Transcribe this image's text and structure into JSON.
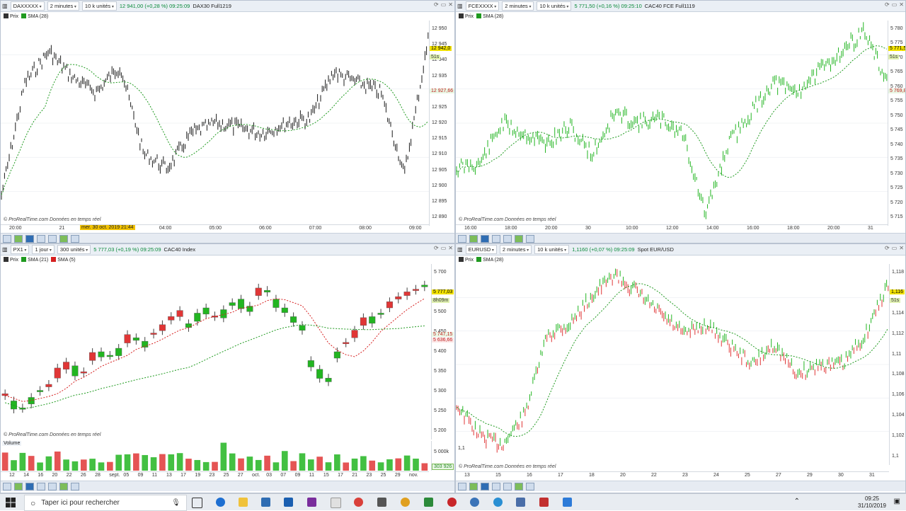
{
  "panels": {
    "dax": {
      "instrument": "DAXXXXX",
      "period": "2 minutes",
      "units": "10 k unités",
      "quote": "12 941,00 (+0,28 %) 09:25:09",
      "name": "DAX30 Full1219",
      "legend": [
        "Prix",
        "SMA (28)"
      ],
      "yticks": [
        "12 950",
        "12 945",
        "12 940",
        "12 935",
        "12 930",
        "12 925",
        "12 920",
        "12 915",
        "12 910",
        "12 905",
        "12 900",
        "12 895",
        "12 890"
      ],
      "tag1": "12 942,0",
      "tag2": "51s",
      "tag3": "12 927,66",
      "xticks": [
        "20:00",
        "21",
        "03:00",
        "04:00",
        "05:00",
        "06:00",
        "07:00",
        "08:00",
        "09:00"
      ],
      "crosshair_label": "mer. 30 oct. 2019 21:44",
      "credit": "© ProRealTime.com  Données en temps réel"
    },
    "cac_fut": {
      "instrument": "FCEXXXX",
      "period": "2 minutes",
      "units": "10 k unités",
      "quote": "5 771,50 (+0,16 %) 09:25:10",
      "name": "CAC40 FCE Full1119",
      "legend": [
        "Prix",
        "SMA (28)"
      ],
      "yticks": [
        "5 780",
        "5 775",
        "5 770",
        "5 765",
        "5 760",
        "5 755",
        "5 750",
        "5 745",
        "5 740",
        "5 735",
        "5 730",
        "5 725",
        "5 720",
        "5 715"
      ],
      "tag1": "5 771,5",
      "tag2": "51s",
      "tag3": "5 769,8",
      "xticks": [
        "16:00",
        "18:00",
        "20:00",
        "30",
        "10:00",
        "12:00",
        "14:00",
        "16:00",
        "18:00",
        "20:00",
        "31"
      ],
      "credit": "© ProRealTime.com  Données en temps réel"
    },
    "px1": {
      "instrument": "PX1",
      "period": "1 jour",
      "units": "300 unités",
      "quote": "5 777,03 (+0,19 %) 09:25:09",
      "name": "CAC40 Index",
      "legend": [
        "Prix",
        "SMA (21)",
        "SMA (5)"
      ],
      "yticks": [
        "5 700",
        "5 600",
        "5 500",
        "5 450",
        "5 400",
        "5 350",
        "5 300",
        "5 250",
        "5 200"
      ],
      "tag1": "5 777,03",
      "tag2": "8h09m",
      "tag3": "5 747,15",
      "tag4": "5 636,66",
      "vol_label": "Volume",
      "vol_tick": "5 000k",
      "vol_tag": "303 926",
      "xticks": [
        "12",
        "14",
        "16",
        "20",
        "22",
        "26",
        "28",
        "sept.",
        "05",
        "09",
        "11",
        "13",
        "17",
        "19",
        "23",
        "25",
        "27",
        "oct.",
        "03",
        "07",
        "09",
        "11",
        "15",
        "17",
        "21",
        "23",
        "25",
        "29",
        "nov."
      ],
      "credit": "© ProRealTime.com  Données en temps réel"
    },
    "eur": {
      "instrument": "EURUSD",
      "period": "2 minutes",
      "units": "10 k unités",
      "quote": "1,1160 (+0,07 %) 09:25:09",
      "name": "Spot EUR/USD",
      "legend": [
        "Prix",
        "SMA (28)"
      ],
      "yticks": [
        "1,118",
        "1,116",
        "1,114",
        "1,112",
        "1,11",
        "1,108",
        "1,106",
        "1,104",
        "1,102",
        "1,1"
      ],
      "tag1": "1,116",
      "tag2": "51s",
      "low_label": "1,1",
      "xticks": [
        "13",
        "15",
        "16",
        "17",
        "18",
        "20",
        "22",
        "23",
        "24",
        "25",
        "27",
        "29",
        "30",
        "31"
      ],
      "credit": "© ProRealTime.com  Données en temps réel"
    }
  },
  "taskbar": {
    "search_placeholder": "Taper ici pour rechercher",
    "time": "09:25",
    "date": "31/10/2019"
  },
  "colors": {
    "up": "#22b521",
    "down": "#e03636",
    "sma_short": "#d62020",
    "sma_long": "#1f9a1f"
  }
}
